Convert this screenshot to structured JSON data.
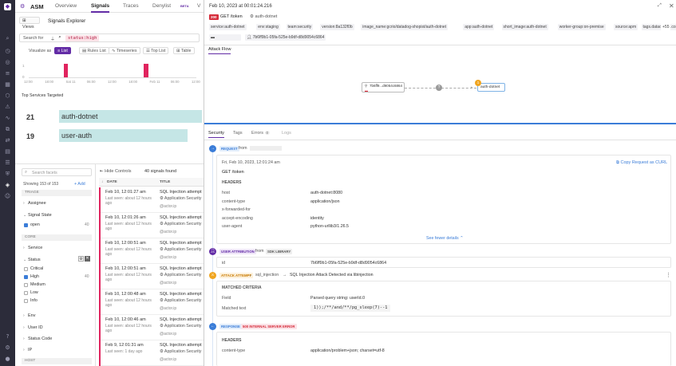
{
  "app": {
    "title": "ASM"
  },
  "nav_tabs": [
    {
      "label": "Overview"
    },
    {
      "label": "Signals"
    },
    {
      "label": "Traces"
    },
    {
      "label": "Denylist"
    },
    {
      "label": "V"
    }
  ],
  "denylist_beta": "BETA",
  "views_label": "Views",
  "explorer_title": "Signals Explorer",
  "search": {
    "label": "Search for",
    "query": "status:high"
  },
  "visualize": {
    "label": "Visualize as",
    "options": [
      {
        "label": "List",
        "active": true
      },
      {
        "label": "Rules List"
      },
      {
        "label": "Timeseries"
      },
      {
        "label": "Top List"
      },
      {
        "label": "Table"
      }
    ]
  },
  "histogram": {
    "x_labels": [
      "12:00",
      "18:00",
      "Sat 11",
      "06:00",
      "12:00",
      "18:00",
      "Feb 11",
      "06:00",
      "12:00"
    ],
    "bars": [
      0.0,
      0.0,
      0.0,
      0.0,
      0.0,
      1.0,
      0.0,
      0.0,
      0.0,
      0.0,
      0.0,
      0.0,
      0.0,
      0.0,
      0.0,
      0.0,
      0.0,
      1.0,
      0.0,
      0.0,
      0.0,
      0.0,
      0.0,
      0.0,
      0.0
    ],
    "y_labels": [
      "1",
      "0"
    ],
    "bar_color": "#e0245e"
  },
  "top_services": {
    "title": "Top Services Targeted",
    "items": [
      {
        "count": "21",
        "name": "auth-dotnet",
        "fraction": 1.0
      },
      {
        "count": "19",
        "name": "user-auth",
        "fraction": 0.9
      }
    ]
  },
  "facets": {
    "search_placeholder": "Search facets",
    "showing": "Showing 153 of 153",
    "add": "Add",
    "sections": [
      {
        "title": "TRIAGE"
      },
      {
        "title": "CORE"
      }
    ],
    "assignee": "Assignee",
    "signal_state": "Signal State",
    "open": {
      "label": "open",
      "count": "40"
    },
    "service": "Service",
    "status": "Status",
    "status_options": [
      {
        "label": "Critical",
        "checked": false,
        "count": ""
      },
      {
        "label": "High",
        "checked": true,
        "count": "40"
      },
      {
        "label": "Medium",
        "checked": false,
        "count": ""
      },
      {
        "label": "Low",
        "checked": false,
        "count": ""
      },
      {
        "label": "Info",
        "checked": false,
        "count": ""
      }
    ],
    "env": "Env",
    "user_id": "User ID",
    "status_code": "Status Code",
    "ip": "IP",
    "host_section": "HOST"
  },
  "list": {
    "hide_controls": "Hide Controls",
    "count": "40 signals found",
    "col_date": "DATE",
    "col_title": "TITLE",
    "rows": [
      {
        "date": "Feb 10, 12:01:27 am",
        "seen": "Last seen: about 12 hours ago",
        "title": "SQL Injection attempt",
        "app": "Application Security",
        "user": "@actor.ip"
      },
      {
        "date": "Feb 10, 12:01:26 am",
        "seen": "Last seen: about 12 hours ago",
        "title": "SQL Injection attempt",
        "app": "Application Security",
        "user": "@actor.ip"
      },
      {
        "date": "Feb 10, 12:00:51 am",
        "seen": "Last seen: about 12 hours ago",
        "title": "SQL Injection attempt",
        "app": "Application Security",
        "user": "@actor.ip"
      },
      {
        "date": "Feb 10, 12:00:51 am",
        "seen": "Last seen: about 12 hours ago",
        "title": "SQL Injection attempt",
        "app": "Application Security",
        "user": "@actor.ip"
      },
      {
        "date": "Feb 10, 12:00:48 am",
        "seen": "Last seen: about 12 hours ago",
        "title": "SQL Injection attempt",
        "app": "Application Security",
        "user": "@actor.ip"
      },
      {
        "date": "Feb 10, 12:00:46 am",
        "seen": "Last seen: about 12 hours ago",
        "title": "SQL Injection attempt",
        "app": "Application Security",
        "user": "@actor.ip"
      },
      {
        "date": "Feb 9, 12:01:31 am",
        "seen": "Last seen: 1 day ago",
        "title": "SQL Injection attempt",
        "app": "Application Security",
        "user": "@actor.ip"
      }
    ]
  },
  "panel": {
    "timestamp": "Feb 10, 2023 at 00:01:24.216",
    "method": "200",
    "endpoint": "GET /token",
    "service_badge": "auth-dotnet",
    "tags_row1": [
      "service:auth-dotnet",
      "env:staging",
      "team:security",
      "version:8a132f0b",
      "image_name:gcrio/datadog-shopist/auth-dotnet",
      "app:auth-dotnet",
      "short_image:auth-dotnet",
      "worker-group:on-premise",
      "source:apm",
      "tags.datadoghq.com/service..."
    ],
    "tags_more": "+55",
    "trace_id": "7b6ff9b1-05fa-525e-b9df-d8d9054c6864",
    "attack_flow_tab": "Attack Flow",
    "flow_node_left": "7b6ff9...d9054c6864",
    "flow_node_right": "auth-dotnet",
    "flow_node_count": "1",
    "detail_tabs": [
      {
        "label": "Security",
        "active": true
      },
      {
        "label": "Tags"
      },
      {
        "label": "Errors",
        "count": "0"
      },
      {
        "label": "Logs"
      }
    ],
    "request": {
      "badge": "REQUEST",
      "from": "from",
      "time": "Fri, Feb 10, 2023, 12:01:24 am",
      "copy": "Copy Request as CURL",
      "line": "GET  /token",
      "headers_title": "HEADERS",
      "headers": [
        {
          "k": "host",
          "v": "auth-dotnet:8080"
        },
        {
          "k": "content-type",
          "v": "application/json"
        },
        {
          "k": "x-forwarded-for",
          "v": ""
        },
        {
          "k": "accept-encoding",
          "v": "identity"
        },
        {
          "k": "user-agent",
          "v": "python-urllib3/1.26.5"
        }
      ],
      "see_fewer": "See fewer details"
    },
    "user_attr": {
      "badge": "USER ATTRIBUTION",
      "from": "from",
      "lib": "SDK LIBRARY",
      "key": "id",
      "value": "7b6ff9b1-05fa-525e-b9df-d8d9054c6864"
    },
    "attack": {
      "badge": "ATTACK ATTEMPT",
      "tag": "sql_injection",
      "desc": "SQL Injection Attack Detected via libinjection",
      "criteria": "MATCHED CRITERIA",
      "field_k": "Field",
      "field_v": "Parsed query string: userId.0",
      "matched_k": "Matched text",
      "matched_v": "1));/**/and/**/pg_sleep(7)--1"
    },
    "response": {
      "badge": "RESPONSE",
      "code": "500 INTERNAL SERVER ERROR",
      "headers_title": "HEADERS",
      "ct_k": "content-type",
      "ct_v": "application/problem+json; charset=utf-8"
    }
  },
  "colors": {
    "accent": "#632ca6",
    "critical": "#e0245e",
    "service_bar": "#c5e6e6",
    "rail": "#2c2c3a"
  }
}
